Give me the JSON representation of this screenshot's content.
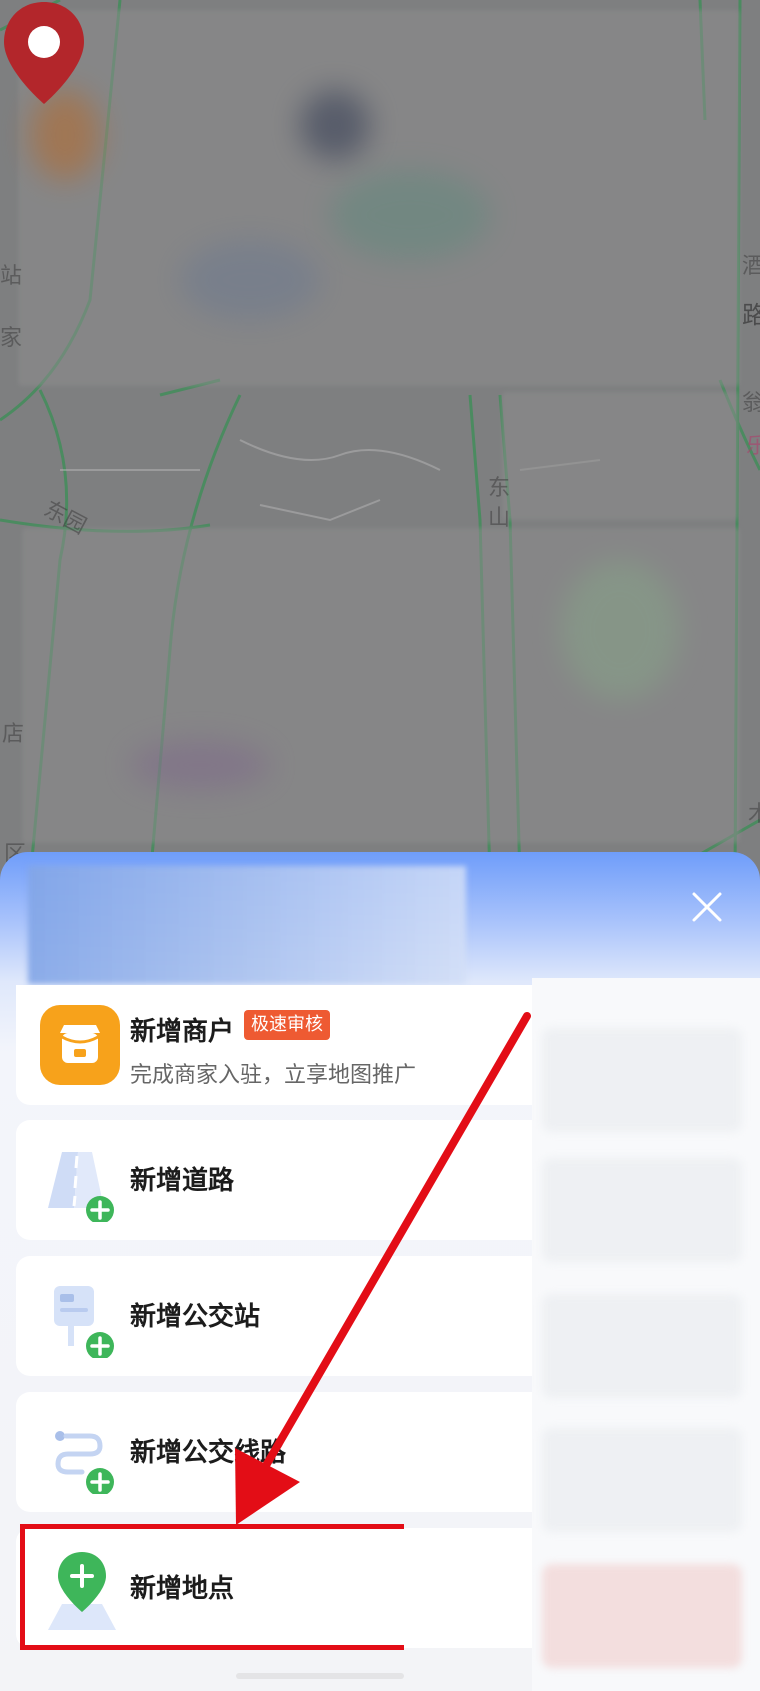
{
  "sheet": {
    "close_icon": "close-icon",
    "items": [
      {
        "id": "merchant",
        "icon": "storefront-icon",
        "title": "新增商户",
        "badge": "极速审核",
        "subtitle": "完成商家入驻，立享地图推广"
      },
      {
        "id": "road",
        "icon": "road-add-icon",
        "title": "新增道路"
      },
      {
        "id": "bus_stop",
        "icon": "bus-stop-add-icon",
        "title": "新增公交站"
      },
      {
        "id": "bus_line",
        "icon": "bus-line-add-icon",
        "title": "新增公交线路"
      },
      {
        "id": "place",
        "icon": "location-add-icon",
        "title": "新增地点"
      }
    ]
  },
  "map": {
    "labels": [
      "东",
      "山",
      "路",
      "区",
      "店",
      "家",
      "站",
      "东园",
      "翁",
      "乐",
      "木",
      "酒"
    ],
    "pin_icon": "map-pin-icon"
  },
  "annotation": {
    "color": "#e30d16",
    "target": "location-add-item"
  },
  "colors": {
    "sheet_top": "#6f9dfa",
    "accent_green": "#3eb65a",
    "badge": "#ee5a32",
    "merchant_icon": "#f7a21b"
  }
}
